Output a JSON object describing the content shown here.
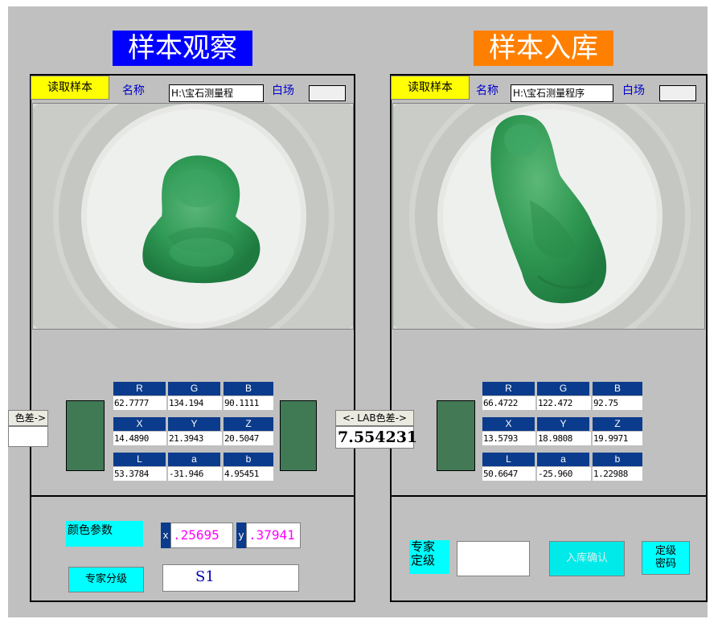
{
  "left": {
    "title": "样本观察",
    "read_button": "读取样本",
    "name_label": "名称",
    "path_value": "H:\\宝石测量程",
    "white_label": "白场",
    "diff_button_partial": "色差->",
    "swatch_color": "#3f7a55",
    "grid": {
      "headers": [
        "R",
        "G",
        "B",
        "X",
        "Y",
        "Z",
        "L",
        "a",
        "b"
      ],
      "values": [
        "62.7777",
        "134.194",
        "90.1111",
        "14.4890",
        "21.3943",
        "20.5047",
        "53.3784",
        "-31.946",
        "4.95451"
      ]
    },
    "color_params_label": "颜色参数",
    "x_tag": "x",
    "x_value": ".25695",
    "y_tag": "y",
    "y_value": ".37941",
    "expert_grade_button": "专家分级",
    "grade_value": "S1"
  },
  "middle": {
    "lab_diff_button": "<- LAB色差->",
    "lab_diff_value": "7.554231",
    "swatch_color": "#3f7a55"
  },
  "right": {
    "title": "样本入库",
    "read_button": "读取样本",
    "name_label": "名称",
    "path_value": "H:\\宝石测量程序",
    "white_label": "白场",
    "swatch_color": "#437a55",
    "grid": {
      "headers": [
        "R",
        "G",
        "B",
        "X",
        "Y",
        "Z",
        "L",
        "a",
        "b"
      ],
      "values": [
        "66.4722",
        "122.472",
        "92.75",
        "13.5793",
        "18.9808",
        "19.9971",
        "50.6647",
        "-25.960",
        "1.22988"
      ]
    },
    "expert_label_line1": "专家",
    "expert_label_line2": "定级",
    "confirm_button": "入库确认",
    "grade_pwd_line1": "定级",
    "grade_pwd_line2": "密码"
  },
  "colors": {
    "left_title_bg": "#0000ff",
    "right_title_bg": "#ff8000",
    "button_yellow": "#ffff00",
    "button_cyan": "#00ffff",
    "header_blue": "#0b3b8c",
    "panel_gray": "#c0c0c0"
  }
}
